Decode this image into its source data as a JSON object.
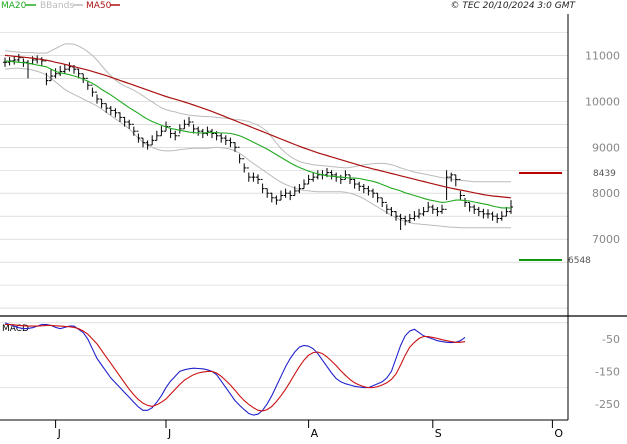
{
  "legend": {
    "ma20": "MA20",
    "bbands": "BBands",
    "ma50": "MA50"
  },
  "copyright": "© TEC 20/10/2024 3:0 GMT",
  "colors": {
    "ma20": "#22aa22",
    "ma50": "#aa1111",
    "bbands": "#bbbbbb",
    "price": "#000000",
    "macd": "#2222cc",
    "signal": "#cc1111",
    "resistance": "#bb0000",
    "support": "#119911",
    "grid": "#cccccc",
    "axis_text": "#888888"
  },
  "levels": {
    "resistance_label": "8439",
    "support_label": "6548"
  },
  "chart_data": [
    {
      "type": "ohlc",
      "ylim": [
        5350,
        11900
      ],
      "yticks": [
        {
          "value": 7000,
          "label": "7000"
        },
        {
          "value": 8000,
          "label": "8000"
        },
        {
          "value": 9000,
          "label": "9000"
        },
        {
          "value": 10000,
          "label": "10000"
        },
        {
          "value": 11000,
          "label": "11000"
        }
      ],
      "x_months": [
        {
          "label": "J",
          "index": 11
        },
        {
          "label": "J",
          "index": 35
        },
        {
          "label": "A",
          "index": 66
        },
        {
          "label": "S",
          "index": 93
        },
        {
          "label": "O",
          "index": 119
        }
      ],
      "close": [
        10850,
        10880,
        10900,
        10950,
        10850,
        10820,
        10900,
        10920,
        10880,
        10450,
        10550,
        10600,
        10650,
        10700,
        10750,
        10700,
        10600,
        10500,
        10350,
        10200,
        10050,
        9950,
        9850,
        9800,
        9750,
        9650,
        9550,
        9500,
        9350,
        9200,
        9100,
        9050,
        9150,
        9250,
        9350,
        9450,
        9300,
        9250,
        9400,
        9500,
        9550,
        9400,
        9350,
        9300,
        9350,
        9300,
        9250,
        9200,
        9150,
        9100,
        9000,
        8750,
        8550,
        8350,
        8350,
        8300,
        8100,
        8000,
        7900,
        7850,
        7950,
        8000,
        7950,
        8050,
        8100,
        8200,
        8300,
        8350,
        8400,
        8400,
        8450,
        8400,
        8350,
        8300,
        8400,
        8300,
        8200,
        8150,
        8100,
        8050,
        8000,
        7900,
        7800,
        7650,
        7600,
        7500,
        7450,
        7400,
        7450,
        7500,
        7550,
        7600,
        7700,
        7650,
        7600,
        7650,
        8350,
        8400,
        8300,
        7950,
        7800,
        7700,
        7650,
        7600,
        7550,
        7550,
        7500,
        7450,
        7500,
        7600,
        7700
      ],
      "high": [
        10950,
        10960,
        10980,
        11030,
        10930,
        10900,
        10980,
        11000,
        10960,
        10620,
        10700,
        10720,
        10770,
        10810,
        10850,
        10790,
        10700,
        10600,
        10450,
        10300,
        10150,
        10050,
        9950,
        9900,
        9850,
        9760,
        9660,
        9600,
        9450,
        9300,
        9200,
        9150,
        9260,
        9360,
        9460,
        9560,
        9400,
        9360,
        9500,
        9600,
        9660,
        9500,
        9450,
        9400,
        9450,
        9400,
        9350,
        9300,
        9260,
        9210,
        9110,
        8850,
        8650,
        8450,
        8450,
        8410,
        8210,
        8100,
        8010,
        7950,
        8060,
        8100,
        8060,
        8150,
        8200,
        8300,
        8400,
        8450,
        8500,
        8500,
        8550,
        8500,
        8450,
        8400,
        8500,
        8400,
        8310,
        8250,
        8200,
        8160,
        8100,
        8000,
        7900,
        7760,
        7700,
        7610,
        7550,
        7510,
        7550,
        7610,
        7660,
        7700,
        7810,
        7750,
        7700,
        7750,
        8500,
        8450,
        8400,
        8050,
        7900,
        7800,
        7750,
        7700,
        7660,
        7650,
        7600,
        7560,
        7610,
        7700,
        7850
      ],
      "low": [
        10750,
        10780,
        10800,
        10850,
        10750,
        10500,
        10800,
        10820,
        10780,
        10350,
        10450,
        10500,
        10550,
        10600,
        10650,
        10600,
        10500,
        10400,
        10250,
        10100,
        9950,
        9850,
        9750,
        9700,
        9650,
        9550,
        9450,
        9400,
        9250,
        9100,
        9000,
        8950,
        9050,
        9150,
        9250,
        9350,
        9200,
        9150,
        9300,
        9400,
        9450,
        9300,
        9250,
        9200,
        9250,
        9200,
        9150,
        9100,
        9050,
        9000,
        8900,
        8650,
        8450,
        8250,
        8250,
        8200,
        8000,
        7900,
        7800,
        7750,
        7850,
        7900,
        7850,
        7950,
        8000,
        8100,
        8200,
        8250,
        8300,
        8300,
        8350,
        8300,
        8250,
        8200,
        8300,
        8200,
        8100,
        8050,
        8000,
        7950,
        7900,
        7800,
        7700,
        7550,
        7500,
        7400,
        7200,
        7300,
        7350,
        7400,
        7450,
        7500,
        7600,
        7550,
        7500,
        7550,
        7850,
        8250,
        8150,
        7850,
        7700,
        7600,
        7550,
        7500,
        7450,
        7450,
        7400,
        7350,
        7400,
        7500,
        7550
      ],
      "ma20": [
        10880,
        10870,
        10860,
        10850,
        10840,
        10830,
        10810,
        10790,
        10770,
        10750,
        10700,
        10650,
        10620,
        10600,
        10580,
        10550,
        10520,
        10480,
        10440,
        10390,
        10330,
        10260,
        10200,
        10140,
        10070,
        10000,
        9930,
        9860,
        9800,
        9740,
        9670,
        9610,
        9560,
        9520,
        9480,
        9440,
        9410,
        9390,
        9370,
        9350,
        9330,
        9320,
        9310,
        9310,
        9320,
        9320,
        9320,
        9310,
        9310,
        9300,
        9280,
        9250,
        9210,
        9160,
        9110,
        9060,
        9010,
        8960,
        8900,
        8840,
        8780,
        8720,
        8660,
        8610,
        8560,
        8520,
        8480,
        8450,
        8420,
        8400,
        8380,
        8370,
        8360,
        8350,
        8340,
        8330,
        8330,
        8320,
        8300,
        8280,
        8260,
        8230,
        8190,
        8150,
        8110,
        8080,
        8050,
        8010,
        7980,
        7950,
        7920,
        7890,
        7860,
        7840,
        7820,
        7800,
        7810,
        7830,
        7850,
        7850,
        7840,
        7830,
        7810,
        7790,
        7770,
        7750,
        7720,
        7700,
        7680,
        7680,
        7680
      ],
      "ma50": [
        11000,
        10990,
        10980,
        10970,
        10960,
        10950,
        10940,
        10925,
        10910,
        10895,
        10875,
        10850,
        10830,
        10805,
        10780,
        10755,
        10730,
        10705,
        10680,
        10650,
        10620,
        10590,
        10560,
        10525,
        10490,
        10455,
        10420,
        10385,
        10350,
        10315,
        10280,
        10245,
        10210,
        10175,
        10140,
        10105,
        10075,
        10045,
        10015,
        9985,
        9955,
        9920,
        9885,
        9850,
        9815,
        9780,
        9740,
        9700,
        9660,
        9620,
        9580,
        9540,
        9500,
        9460,
        9420,
        9380,
        9340,
        9300,
        9260,
        9220,
        9180,
        9140,
        9100,
        9060,
        9020,
        8985,
        8950,
        8915,
        8880,
        8850,
        8820,
        8790,
        8760,
        8730,
        8700,
        8670,
        8640,
        8610,
        8580,
        8555,
        8530,
        8505,
        8480,
        8455,
        8430,
        8405,
        8380,
        8355,
        8330,
        8305,
        8280,
        8255,
        8230,
        8205,
        8180,
        8155,
        8130,
        8110,
        8090,
        8070,
        8050,
        8030,
        8010,
        7990,
        7970,
        7955,
        7940,
        7930,
        7920,
        7910,
        7900
      ],
      "bb_upper": [
        11100,
        11090,
        11080,
        11070,
        11060,
        11060,
        11060,
        11050,
        11050,
        11050,
        11100,
        11150,
        11200,
        11250,
        11250,
        11240,
        11200,
        11150,
        11080,
        11000,
        10900,
        10780,
        10660,
        10560,
        10460,
        10390,
        10330,
        10290,
        10240,
        10180,
        10120,
        10050,
        9990,
        9920,
        9860,
        9820,
        9790,
        9770,
        9740,
        9720,
        9700,
        9690,
        9680,
        9670,
        9670,
        9660,
        9650,
        9640,
        9630,
        9620,
        9600,
        9600,
        9580,
        9560,
        9520,
        9480,
        9420,
        9340,
        9220,
        9090,
        8970,
        8880,
        8800,
        8740,
        8690,
        8660,
        8640,
        8620,
        8610,
        8600,
        8590,
        8580,
        8570,
        8560,
        8550,
        8560,
        8580,
        8600,
        8620,
        8630,
        8640,
        8650,
        8650,
        8640,
        8620,
        8590,
        8550,
        8520,
        8490,
        8460,
        8440,
        8420,
        8400,
        8380,
        8360,
        8340,
        8330,
        8310,
        8290,
        8280,
        8270,
        8260,
        8250,
        8250,
        8250,
        8250,
        8250,
        8250,
        8250,
        8250,
        8250
      ],
      "bb_lower": [
        10700,
        10710,
        10720,
        10720,
        10710,
        10700,
        10680,
        10650,
        10620,
        10580,
        10500,
        10420,
        10340,
        10260,
        10200,
        10150,
        10100,
        10050,
        10000,
        9950,
        9900,
        9830,
        9760,
        9690,
        9620,
        9550,
        9480,
        9400,
        9300,
        9190,
        9110,
        9050,
        9000,
        8960,
        8930,
        8920,
        8920,
        8930,
        8950,
        8960,
        8970,
        8980,
        8980,
        8980,
        8980,
        8990,
        9000,
        8990,
        8980,
        8960,
        8920,
        8870,
        8800,
        8720,
        8650,
        8580,
        8510,
        8440,
        8370,
        8300,
        8240,
        8190,
        8150,
        8110,
        8080,
        8060,
        8050,
        8040,
        8030,
        8030,
        8030,
        8030,
        8030,
        8030,
        8020,
        8000,
        7970,
        7930,
        7880,
        7820,
        7760,
        7700,
        7640,
        7580,
        7520,
        7470,
        7420,
        7390,
        7360,
        7340,
        7330,
        7320,
        7310,
        7300,
        7290,
        7280,
        7270,
        7260,
        7260,
        7250,
        7250,
        7250,
        7250,
        7250,
        7250,
        7250,
        7250,
        7250,
        7250,
        7250,
        7250
      ]
    },
    {
      "type": "line",
      "title": "MACD",
      "ylim": [
        -300,
        15
      ],
      "yticks": [
        {
          "value": -50,
          "label": "-50"
        },
        {
          "value": -150,
          "label": "-150"
        },
        {
          "value": -250,
          "label": "-250"
        }
      ],
      "series": [
        {
          "values": [
            0,
            -5,
            -10,
            -15,
            -18,
            -17,
            -15,
            -10,
            -5,
            -5,
            -8,
            -14,
            -18,
            -14,
            -10,
            -10,
            -20,
            -30,
            -50,
            -80,
            -110,
            -130,
            -150,
            -170,
            -185,
            -200,
            -215,
            -230,
            -245,
            -260,
            -270,
            -270,
            -262,
            -245,
            -225,
            -200,
            -180,
            -165,
            -150,
            -145,
            -142,
            -140,
            -141,
            -142,
            -145,
            -150,
            -160,
            -180,
            -200,
            -220,
            -240,
            -255,
            -268,
            -280,
            -285,
            -282,
            -270,
            -250,
            -225,
            -195,
            -165,
            -135,
            -110,
            -90,
            -75,
            -70,
            -72,
            -80,
            -95,
            -115,
            -135,
            -155,
            -172,
            -182,
            -188,
            -192,
            -196,
            -198,
            -200,
            -200,
            -194,
            -188,
            -182,
            -170,
            -150,
            -110,
            -70,
            -40,
            -25,
            -20,
            -30,
            -40,
            -45,
            -50,
            -55,
            -58,
            -60,
            -61,
            -60,
            -55,
            -45
          ]
        },
        {
          "values": [
            -5,
            -5,
            -6,
            -8,
            -9,
            -10,
            -10,
            -10,
            -9,
            -8,
            -8,
            -9,
            -10,
            -11,
            -12,
            -14,
            -18,
            -25,
            -35,
            -50,
            -65,
            -85,
            -105,
            -125,
            -145,
            -165,
            -185,
            -205,
            -222,
            -237,
            -248,
            -255,
            -258,
            -253,
            -245,
            -235,
            -220,
            -205,
            -190,
            -177,
            -168,
            -160,
            -155,
            -152,
            -150,
            -150,
            -155,
            -165,
            -178,
            -192,
            -208,
            -225,
            -240,
            -252,
            -262,
            -270,
            -272,
            -268,
            -258,
            -243,
            -225,
            -205,
            -182,
            -158,
            -135,
            -115,
            -100,
            -92,
            -90,
            -95,
            -105,
            -118,
            -132,
            -148,
            -162,
            -175,
            -185,
            -192,
            -197,
            -200,
            -200,
            -197,
            -192,
            -185,
            -175,
            -158,
            -130,
            -100,
            -75,
            -60,
            -48,
            -42,
            -42,
            -45,
            -48,
            -52,
            -55,
            -58,
            -60,
            -60,
            -58
          ]
        }
      ]
    }
  ]
}
